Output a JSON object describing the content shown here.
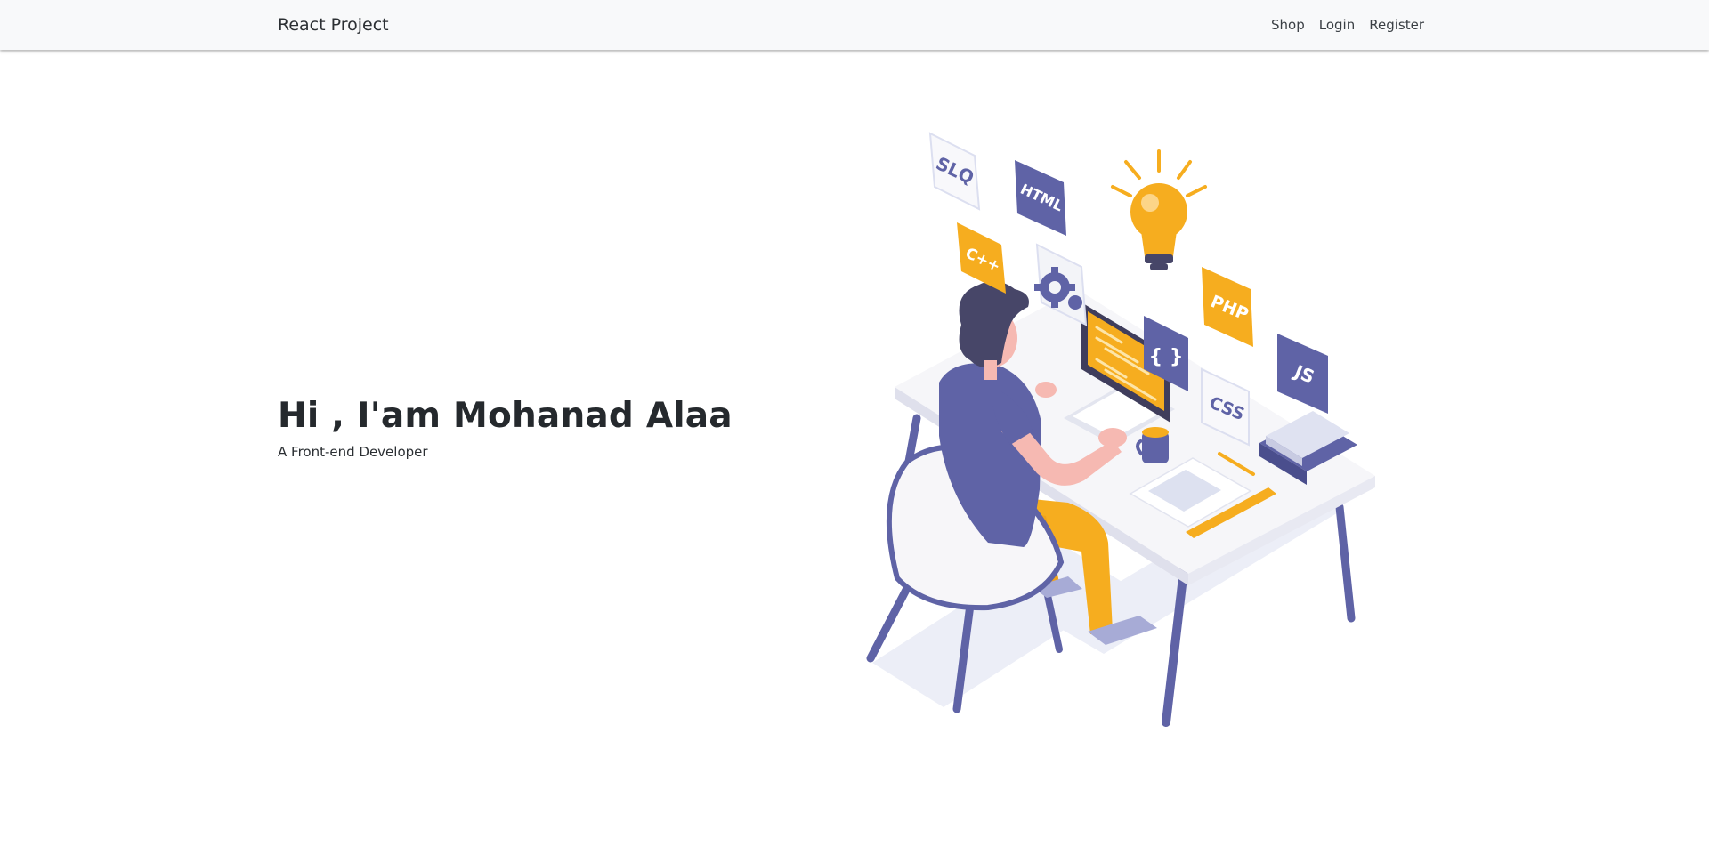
{
  "navbar": {
    "brand": "React Project",
    "links": [
      "Shop",
      "Login",
      "Register"
    ]
  },
  "hero": {
    "title": "Hi , I'am Mohanad Alaa",
    "subtitle": "A Front-end Developer"
  },
  "illustration": {
    "tiles": [
      "SLQ",
      "HTML",
      "C++",
      "PHP",
      "JS",
      "CSS",
      "{ }"
    ],
    "colors": {
      "purple": "#5f63a6",
      "orange": "#f6ad1f",
      "light": "#f3f4f8",
      "skin": "#f6b9b2",
      "hair": "#474668",
      "shadow": "#e7e9f5"
    }
  }
}
